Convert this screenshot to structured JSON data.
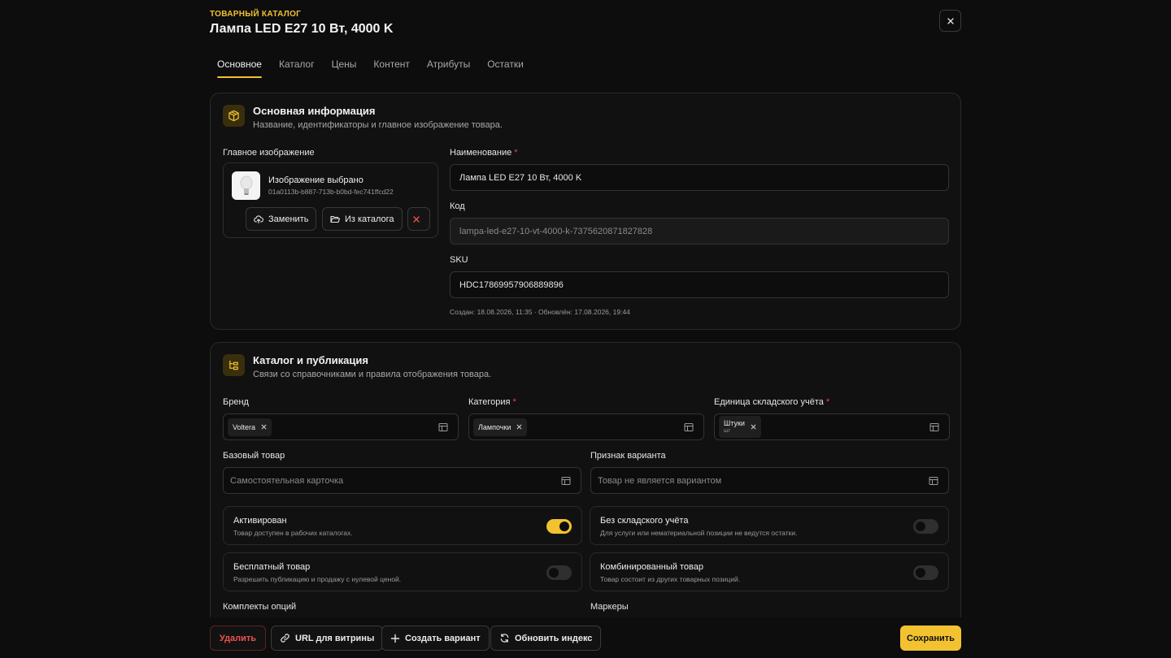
{
  "header": {
    "eyebrow": "ТОВАРНЫЙ КАТАЛОГ",
    "title": "Лампа LED E27 10 Вт, 4000 K"
  },
  "tabs": [
    {
      "label": "Основное",
      "active": true
    },
    {
      "label": "Каталог"
    },
    {
      "label": "Цены"
    },
    {
      "label": "Контент"
    },
    {
      "label": "Атрибуты"
    },
    {
      "label": "Остатки"
    }
  ],
  "basic": {
    "title": "Основная информация",
    "subtitle": "Название, идентификаторы и главное изображение товара.",
    "image_label": "Главное изображение",
    "image_name": "Изображение выбрано",
    "image_id": "01a0113b-b887-713b-b0bd-fec741ffcd22",
    "replace_label": "Заменить",
    "from_catalog_label": "Из каталога",
    "name_label": "Наименование",
    "name_value": "Лампа LED E27 10 Вт, 4000 K",
    "code_label": "Код",
    "code_value": "lampa-led-e27-10-vt-4000-k-7375620871827828",
    "sku_label": "SKU",
    "sku_value": "HDC17869957906889896",
    "meta": "Создан: 18.08.2026, 11:35 · Обновлён: 17.08.2026, 19:44",
    "required_mark": "*"
  },
  "catalog": {
    "title": "Каталог и публикация",
    "subtitle": "Связи со справочниками и правила отображения товара.",
    "brand_label": "Бренд",
    "brand_value": "Voltera",
    "category_label": "Категория",
    "category_value": "Лампочки",
    "unit_label": "Единица складского учёта",
    "unit_value": "Штуки",
    "unit_short": "шт",
    "base_label": "Базовый товар",
    "base_placeholder": "Самостоятельная карточка",
    "variant_label": "Признак варианта",
    "variant_placeholder": "Товар не является вариантом",
    "toggles": [
      {
        "title": "Активирован",
        "sub": "Товар доступен в рабочих каталогах.",
        "on": true
      },
      {
        "title": "Без складского учёта",
        "sub": "Для услуги или нематериальной позиции не ведутся остатки.",
        "on": false
      },
      {
        "title": "Бесплатный товар",
        "sub": "Разрешить публикацию и продажу с нулевой ценой.",
        "on": false
      },
      {
        "title": "Комбинированный товар",
        "sub": "Товар состоит из других товарных позиций.",
        "on": false
      }
    ],
    "options_label": "Комплекты опций",
    "markers_label": "Маркеры"
  },
  "footer": {
    "delete_label": "Удалить",
    "url_label": "URL для витрины",
    "variant_label": "Создать вариант",
    "reindex_label": "Обновить индекс",
    "save_label": "Сохранить"
  },
  "colors": {
    "accent": "#f2c230",
    "danger": "#f05252",
    "background": "#0d0d0d"
  }
}
